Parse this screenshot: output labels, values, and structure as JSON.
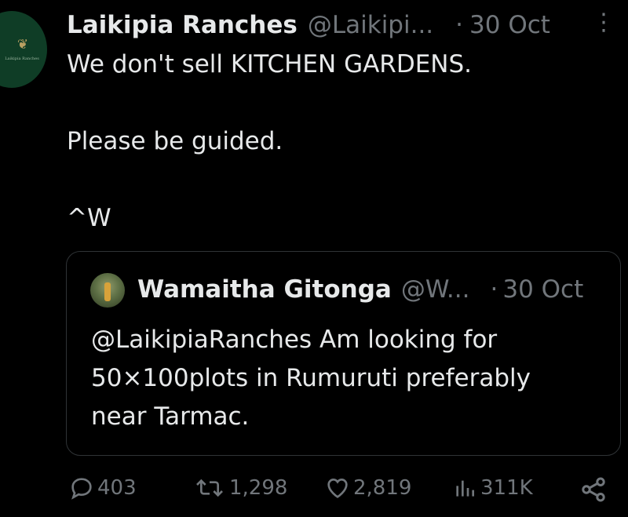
{
  "tweet": {
    "author_name": "Laikipia Ranches",
    "handle": "@Laikipi...",
    "separator": "·",
    "date": "30 Oct",
    "avatar_text": "Laikipia Ranches",
    "lines": [
      "We don't sell KITCHEN GARDENS.",
      "",
      "Please be guided.",
      "",
      "^W"
    ]
  },
  "quoted": {
    "author_name": "Wamaitha Gitonga",
    "handle": "@W...",
    "separator": "·",
    "date": "30 Oct",
    "lines": [
      "@LaikipiaRanches Am looking for",
      "50×100plots in Rumuruti preferably",
      "near Tarmac."
    ]
  },
  "actions": {
    "replies": "403",
    "reposts": "1,298",
    "likes": "2,819",
    "views": "311K"
  },
  "colors": {
    "background": "#000000",
    "text": "#e7e9ea",
    "muted": "#71767b",
    "border": "#2f3336",
    "avatar_bg": "#0f3d26"
  }
}
